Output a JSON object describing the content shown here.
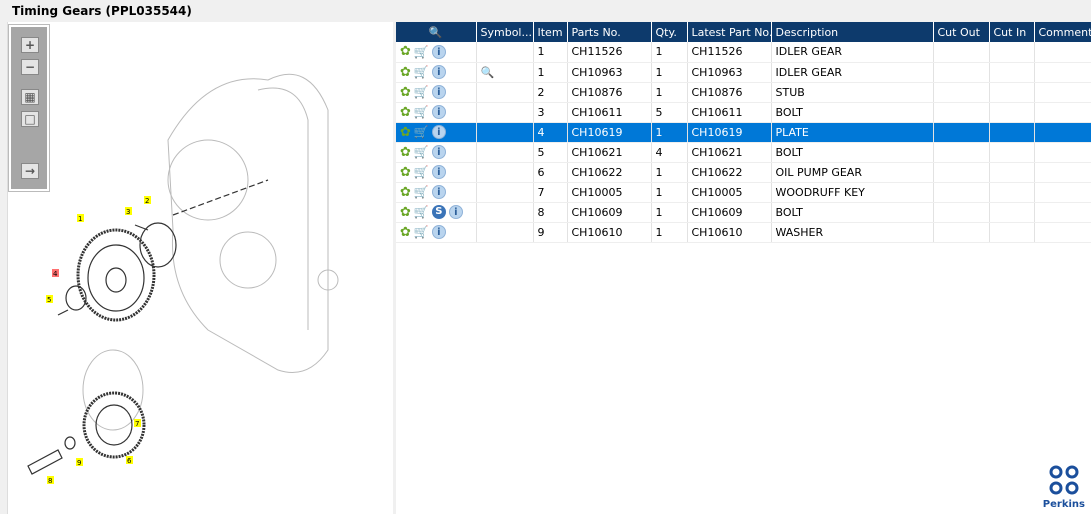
{
  "title": "Timing Gears (PPL035544)",
  "toolbar": {
    "zoom_in": "+",
    "zoom_out": "−"
  },
  "diagram": {
    "callouts": [
      "1",
      "2",
      "3",
      "4",
      "5",
      "6",
      "7",
      "8",
      "9"
    ]
  },
  "table": {
    "headers": {
      "symbol": "Symbol...",
      "item": "Item",
      "parts_no": "Parts No.",
      "qty": "Qty.",
      "latest": "Latest Part No.",
      "description": "Description",
      "cut_out": "Cut Out",
      "cut_in": "Cut In",
      "comment": "Comment"
    },
    "rows": [
      {
        "item": "1",
        "parts_no": "CH11526",
        "qty": "1",
        "latest": "CH11526",
        "description": "IDLER GEAR"
      },
      {
        "item": "1",
        "parts_no": "CH10963",
        "qty": "1",
        "latest": "CH10963",
        "description": "IDLER GEAR",
        "symbol": "magnifier-book-icon"
      },
      {
        "item": "2",
        "parts_no": "CH10876",
        "qty": "1",
        "latest": "CH10876",
        "description": "STUB"
      },
      {
        "item": "3",
        "parts_no": "CH10611",
        "qty": "5",
        "latest": "CH10611",
        "description": "BOLT"
      },
      {
        "item": "4",
        "parts_no": "CH10619",
        "qty": "1",
        "latest": "CH10619",
        "description": "PLATE",
        "selected": true
      },
      {
        "item": "5",
        "parts_no": "CH10621",
        "qty": "4",
        "latest": "CH10621",
        "description": "BOLT"
      },
      {
        "item": "6",
        "parts_no": "CH10622",
        "qty": "1",
        "latest": "CH10622",
        "description": "OIL PUMP GEAR"
      },
      {
        "item": "7",
        "parts_no": "CH10005",
        "qty": "1",
        "latest": "CH10005",
        "description": "WOODRUFF KEY"
      },
      {
        "item": "8",
        "parts_no": "CH10609",
        "qty": "1",
        "latest": "CH10609",
        "description": "BOLT",
        "badge": "S"
      },
      {
        "item": "9",
        "parts_no": "CH10610",
        "qty": "1",
        "latest": "CH10610",
        "description": "WASHER"
      }
    ]
  },
  "logo": {
    "text": "Perkins"
  },
  "colors": {
    "header": "#0d3a6c",
    "selected": "#0078d7"
  }
}
